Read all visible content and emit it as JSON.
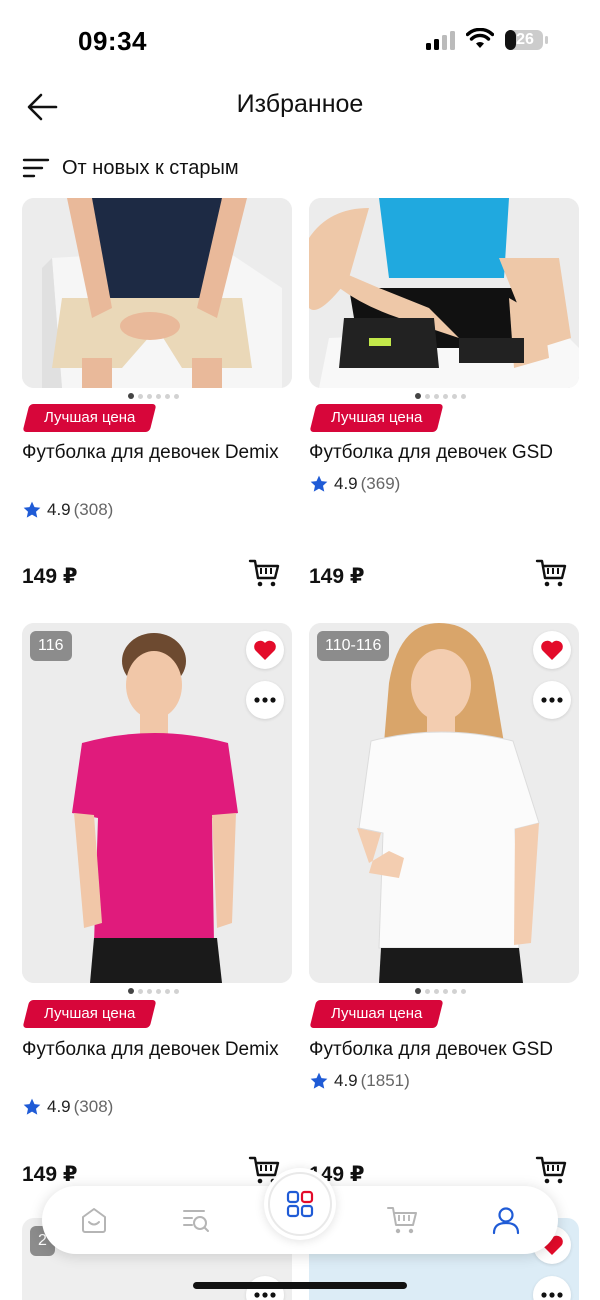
{
  "status_bar": {
    "time": "09:34",
    "battery": "26"
  },
  "header": {
    "title": "Избранное"
  },
  "sort": {
    "label": "От новых к старым"
  },
  "products": [
    {
      "badge": "Лучшая цена",
      "name": "Футболка для девочек Demix",
      "rating": "4.9",
      "reviews": "(308)",
      "price": "149 ₽",
      "image": "girl-navy-tshirt-beige-shorts"
    },
    {
      "badge": "Лучшая цена",
      "name": "Футболка для девочек GSD",
      "rating": "4.9",
      "reviews": "(369)",
      "price": "149 ₽",
      "image": "girl-blue-tshirt-black-shorts"
    },
    {
      "size": "116",
      "badge": "Лучшая цена",
      "name": "Футболка для девочек Demix",
      "rating": "4.9",
      "reviews": "(308)",
      "price": "149 ₽",
      "image": "girl-pink-tshirt"
    },
    {
      "size": "110-116",
      "badge": "Лучшая цена",
      "name": "Футболка для девочек GSD",
      "rating": "4.9",
      "reviews": "(1851)",
      "price": "149 ₽",
      "image": "girl-white-tshirt"
    },
    {
      "size": "2",
      "image": "partially-visible"
    },
    {
      "image": "partially-visible"
    }
  ],
  "tabbar": {
    "icons": [
      "home-icon",
      "catalog-search-icon",
      "grid-icon",
      "cart-icon",
      "profile-icon"
    ]
  },
  "colors": {
    "badge": "#d7063a",
    "heart": "#e30b2a",
    "accent": "#1f5bd6",
    "star": "#1f5bd6"
  }
}
